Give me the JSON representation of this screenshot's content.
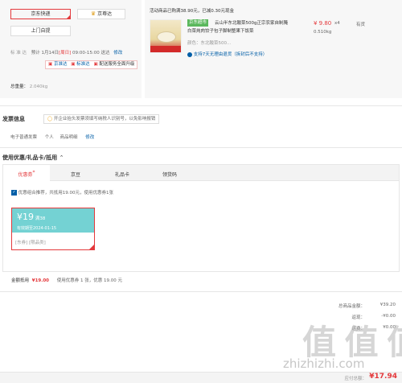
{
  "shipping": {
    "option_jd": "京东快递",
    "option_jingzhunda": "京尊达",
    "option_pickup": "上门自提",
    "standard_label": "标  准  达",
    "standard_time_prefix": "预计 1月14日",
    "standard_time_day": "[周日]",
    "standard_time_range": "09:00-15:00 送达",
    "modify": "修改",
    "badge1": "京准达",
    "badge2": "标准达",
    "badge3": "配送服务全面升级",
    "total_weight_label": "总重量：",
    "total_weight_value": "2.040kg"
  },
  "product": {
    "promo": "活动商品已购满38.90元，已减0.30元现金",
    "self_tag": "京东超市",
    "title": "云山半东北酸菜500g正宗农家自制腌白菜炖肉饺子包子脚制整果下饭菜",
    "price": "¥ 9.80",
    "qty": "x4",
    "stock": "有货",
    "weight": "0.510kg",
    "color_label": "颜色：东北酸菜500...",
    "return_policy": "支持7天无理由退货（拆封后不支持）"
  },
  "invoice": {
    "heading": "发票信息",
    "notice": "开企业抬头发票须填写纳税人识别号，以免影响报销",
    "type": "电子普通发票",
    "title_type": "个人",
    "content": "商品明细",
    "modify": "修改"
  },
  "discount": {
    "heading": "使用优惠/礼品卡/抵用",
    "tabs": [
      "优惠券",
      "京豆",
      "礼品卡",
      "领货码"
    ],
    "checkbox_text": "优惠组合推荐，共抵用19.00元，使用优惠券1张",
    "coupon_amount": "¥19",
    "coupon_condition": "满38",
    "coupon_expiry": "有效期至2024-01-15",
    "coupon_tags": "[东券] [限品类]",
    "summary_label": "金额抵用",
    "summary_amount": "¥19.00",
    "summary_text": "使用优惠券 1 张，优惠 19.00 元"
  },
  "totals": {
    "goods_label": "总商品金额：",
    "goods_value": "¥39.20",
    "row2_label": "返现：",
    "row2_value": "-¥0.00",
    "row3_label": "运费：",
    "row3_value": "¥0.00",
    "row4_label": "",
    "row4_value": "",
    "row5_label": "",
    "row5_value": "",
    "pay_label": "应付总额：",
    "pay_value": "¥17.94"
  },
  "watermark": {
    "text": "值 值 值",
    "url": "zhizhizhi.com"
  },
  "colors": {
    "accent": "#e4393c",
    "coupon_bg": "#74d2d3",
    "self_tag_bg": "#5bb85d"
  }
}
